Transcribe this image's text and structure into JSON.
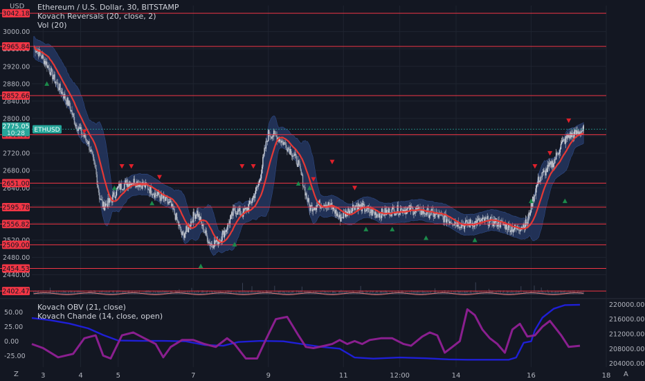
{
  "header": {
    "currency": "USD",
    "title": "Ethereum / U.S. Dollar, 30, BITSTAMP",
    "indicator_1": "Kovach Reversals (20, close, 2)",
    "indicator_2": "Vol (20)"
  },
  "lower_panel": {
    "indicator_1": "Kovach OBV (21, close)",
    "indicator_2": "Kovach Chande (14, close, open)"
  },
  "footer": {
    "left_icon_label": "Z",
    "right_icon_label": "A"
  },
  "colors": {
    "background": "#131722",
    "grid": "#1f2430",
    "level_line": "#f23645",
    "candle_up": "#cfd3dc",
    "candle_down": "#9aa0ab",
    "band_fill": "#24365f",
    "ma_line": "#e53935",
    "buy_marker": "#1b8a4a",
    "sell_marker": "#e0202a",
    "price_tag": "#26a69a",
    "obv_line": "#1f1fd6",
    "chande_line": "#8a1f8f",
    "axis_text": "#b2b5be"
  },
  "chart_data": [
    {
      "type": "candlestick",
      "name": "ETHUSD",
      "title": "Ethereum / U.S. Dollar, 30, BITSTAMP",
      "y_axis": {
        "ylim": [
          2390,
          3060
        ],
        "ticks": [
          2440,
          2480,
          2520,
          2560,
          2600,
          2640,
          2680,
          2720,
          2760,
          2800,
          2840,
          2880,
          2920,
          2960,
          3000
        ]
      },
      "x_axis": {
        "ticks": [
          "3",
          "4",
          "5",
          "7",
          "9",
          "11",
          "12:00",
          "14",
          "16",
          "18"
        ],
        "tick_days": [
          3,
          4,
          5,
          7,
          9,
          11,
          12.5,
          14,
          16,
          18
        ],
        "xlim": [
          2.7,
          18
        ]
      },
      "current_price": {
        "label": "ETHUSD",
        "value": "2775.05",
        "countdown": "10:28"
      },
      "levels": [
        3042.18,
        2965.84,
        2852.66,
        2762.6,
        2651.0,
        2595.78,
        2556.82,
        2509.0,
        2454.53,
        2402.47
      ],
      "close_path": [
        [
          2.75,
          2965
        ],
        [
          2.9,
          2950
        ],
        [
          3.1,
          2925
        ],
        [
          3.3,
          2890
        ],
        [
          3.5,
          2860
        ],
        [
          3.7,
          2830
        ],
        [
          3.85,
          2790
        ],
        [
          4.0,
          2770
        ],
        [
          4.2,
          2745
        ],
        [
          4.4,
          2680
        ],
        [
          4.5,
          2620
        ],
        [
          4.6,
          2598
        ],
        [
          4.8,
          2610
        ],
        [
          5.0,
          2640
        ],
        [
          5.2,
          2650
        ],
        [
          5.4,
          2655
        ],
        [
          5.6,
          2650
        ],
        [
          5.8,
          2640
        ],
        [
          6.0,
          2625
        ],
        [
          6.2,
          2615
        ],
        [
          6.4,
          2600
        ],
        [
          6.55,
          2570
        ],
        [
          6.7,
          2530
        ],
        [
          6.85,
          2545
        ],
        [
          7.0,
          2575
        ],
        [
          7.1,
          2585
        ],
        [
          7.25,
          2550
        ],
        [
          7.45,
          2510
        ],
        [
          7.7,
          2520
        ],
        [
          7.9,
          2550
        ],
        [
          8.1,
          2590
        ],
        [
          8.3,
          2580
        ],
        [
          8.5,
          2600
        ],
        [
          8.75,
          2650
        ],
        [
          8.9,
          2725
        ],
        [
          9.0,
          2765
        ],
        [
          9.2,
          2760
        ],
        [
          9.4,
          2745
        ],
        [
          9.6,
          2725
        ],
        [
          9.8,
          2695
        ],
        [
          10.0,
          2625
        ],
        [
          10.1,
          2595
        ],
        [
          10.3,
          2600
        ],
        [
          10.5,
          2605
        ],
        [
          10.7,
          2595
        ],
        [
          10.9,
          2570
        ],
        [
          11.1,
          2585
        ],
        [
          11.3,
          2600
        ],
        [
          11.5,
          2595
        ],
        [
          11.7,
          2585
        ],
        [
          11.9,
          2580
        ],
        [
          12.2,
          2585
        ],
        [
          12.5,
          2590
        ],
        [
          12.8,
          2590
        ],
        [
          13.1,
          2585
        ],
        [
          13.4,
          2580
        ],
        [
          13.7,
          2570
        ],
        [
          14.0,
          2560
        ],
        [
          14.2,
          2555
        ],
        [
          14.5,
          2560
        ],
        [
          14.8,
          2565
        ],
        [
          15.1,
          2560
        ],
        [
          15.4,
          2550
        ],
        [
          15.6,
          2545
        ],
        [
          15.9,
          2560
        ],
        [
          16.0,
          2600
        ],
        [
          16.2,
          2660
        ],
        [
          16.4,
          2680
        ],
        [
          16.6,
          2700
        ],
        [
          16.8,
          2740
        ],
        [
          17.0,
          2760
        ],
        [
          17.2,
          2765
        ],
        [
          17.4,
          2775
        ]
      ],
      "buy_signals": [
        [
          3.1,
          2880
        ],
        [
          4.9,
          2640
        ],
        [
          5.9,
          2605
        ],
        [
          7.2,
          2460
        ],
        [
          8.1,
          2510
        ],
        [
          9.8,
          2650
        ],
        [
          10.1,
          2640
        ],
        [
          11.6,
          2545
        ],
        [
          12.3,
          2545
        ],
        [
          13.2,
          2525
        ],
        [
          14.5,
          2520
        ],
        [
          16.0,
          2610
        ],
        [
          16.9,
          2610
        ]
      ],
      "sell_signals": [
        [
          4.1,
          2770
        ],
        [
          5.1,
          2690
        ],
        [
          5.35,
          2690
        ],
        [
          6.1,
          2665
        ],
        [
          8.3,
          2690
        ],
        [
          8.6,
          2690
        ],
        [
          10.2,
          2660
        ],
        [
          10.7,
          2700
        ],
        [
          11.3,
          2640
        ],
        [
          16.1,
          2690
        ],
        [
          16.5,
          2720
        ],
        [
          17.0,
          2795
        ]
      ]
    },
    {
      "type": "line",
      "y_axis_left": {
        "ylim": [
          -45,
          70
        ],
        "ticks": [
          50.0,
          25.0,
          0.0,
          -25.0
        ]
      },
      "y_axis_right": {
        "ylim": [
          203000,
          221000
        ],
        "ticks": [
          220000.0,
          216000.0,
          212000.0,
          208000.0,
          204000.0
        ]
      },
      "series": [
        {
          "name": "Kovach OBV (21, close)",
          "axis": "right",
          "points": [
            [
              2.7,
              216300
            ],
            [
              3.2,
              215700
            ],
            [
              3.7,
              214800
            ],
            [
              4.2,
              213500
            ],
            [
              4.6,
              211700
            ],
            [
              5.0,
              210200
            ],
            [
              5.6,
              210100
            ],
            [
              6.2,
              210100
            ],
            [
              6.8,
              210000
            ],
            [
              7.3,
              209000
            ],
            [
              7.8,
              208800
            ],
            [
              8.2,
              209800
            ],
            [
              8.8,
              210100
            ],
            [
              9.4,
              210000
            ],
            [
              10.0,
              209100
            ],
            [
              10.4,
              208500
            ],
            [
              10.9,
              208000
            ],
            [
              11.3,
              205600
            ],
            [
              11.8,
              205300
            ],
            [
              12.5,
              205600
            ],
            [
              13.2,
              205400
            ],
            [
              13.8,
              205100
            ],
            [
              14.3,
              205000
            ],
            [
              15.0,
              205000
            ],
            [
              15.4,
              205000
            ],
            [
              15.6,
              205600
            ],
            [
              15.8,
              209600
            ],
            [
              16.0,
              210000
            ],
            [
              16.1,
              213000
            ],
            [
              16.3,
              216400
            ],
            [
              16.6,
              218800
            ],
            [
              16.9,
              219800
            ],
            [
              17.3,
              219900
            ]
          ]
        },
        {
          "name": "Kovach Chande (14, close, open)",
          "axis": "left",
          "points": [
            [
              2.7,
              -5
            ],
            [
              3.0,
              -12
            ],
            [
              3.4,
              -28
            ],
            [
              3.8,
              -22
            ],
            [
              4.1,
              5
            ],
            [
              4.4,
              10
            ],
            [
              4.6,
              -25
            ],
            [
              4.8,
              -30
            ],
            [
              5.1,
              10
            ],
            [
              5.4,
              15
            ],
            [
              5.7,
              5
            ],
            [
              6.0,
              -5
            ],
            [
              6.2,
              -28
            ],
            [
              6.4,
              -10
            ],
            [
              6.7,
              2
            ],
            [
              7.0,
              2
            ],
            [
              7.3,
              -5
            ],
            [
              7.6,
              -10
            ],
            [
              7.9,
              5
            ],
            [
              8.1,
              -5
            ],
            [
              8.4,
              -30
            ],
            [
              8.7,
              -30
            ],
            [
              8.95,
              5
            ],
            [
              9.2,
              38
            ],
            [
              9.5,
              42
            ],
            [
              9.8,
              10
            ],
            [
              10.0,
              -10
            ],
            [
              10.2,
              -12
            ],
            [
              10.5,
              -8
            ],
            [
              10.7,
              -5
            ],
            [
              10.9,
              2
            ],
            [
              11.1,
              -5
            ],
            [
              11.3,
              0
            ],
            [
              11.5,
              -5
            ],
            [
              11.7,
              2
            ],
            [
              12.0,
              5
            ],
            [
              12.3,
              5
            ],
            [
              12.6,
              -5
            ],
            [
              12.8,
              -8
            ],
            [
              13.1,
              8
            ],
            [
              13.3,
              15
            ],
            [
              13.5,
              10
            ],
            [
              13.7,
              -20
            ],
            [
              13.9,
              -10
            ],
            [
              14.1,
              0
            ],
            [
              14.3,
              55
            ],
            [
              14.5,
              45
            ],
            [
              14.7,
              20
            ],
            [
              14.9,
              5
            ],
            [
              15.1,
              -5
            ],
            [
              15.3,
              -20
            ],
            [
              15.5,
              20
            ],
            [
              15.7,
              30
            ],
            [
              15.9,
              8
            ],
            [
              16.1,
              10
            ],
            [
              16.3,
              25
            ],
            [
              16.5,
              35
            ],
            [
              16.8,
              10
            ],
            [
              17.0,
              -10
            ],
            [
              17.3,
              -8
            ]
          ]
        }
      ]
    }
  ]
}
